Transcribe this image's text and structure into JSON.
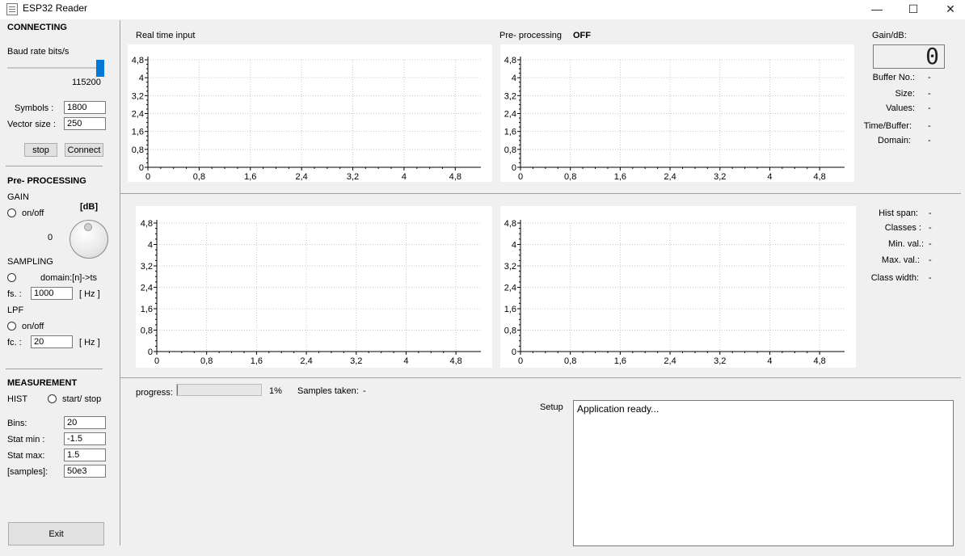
{
  "window": {
    "title": "ESP32 Reader",
    "minimize": "—",
    "maximize": "☐",
    "close": "✕"
  },
  "connecting": {
    "heading": "CONNECTING",
    "baud_label": "Baud rate bits/s",
    "baud_value": "115200",
    "symbols_label": "Symbols :",
    "symbols_value": "1800",
    "vector_label": "Vector size :",
    "vector_value": "250",
    "stop_label": "stop",
    "connect_label": "Connect"
  },
  "preprocessing": {
    "heading": "Pre- PROCESSING",
    "gain_label": "GAIN",
    "gain_onoff": "on/off",
    "db_label": "[dB]",
    "gain_value": "0",
    "sampling_label": "SAMPLING",
    "domain_label": "domain:[n]->ts",
    "fs_label": "fs. :",
    "fs_value": "1000",
    "hz1": "[ Hz ]",
    "lpf_label": "LPF",
    "lpf_onoff": "on/off",
    "fc_label": "fc. :",
    "fc_value": "20",
    "hz2": "[ Hz ]"
  },
  "measurement": {
    "heading": "MEASUREMENT",
    "hist_label": "HIST",
    "startstop_label": "start/ stop",
    "bins_label": "Bins:",
    "bins_value": "20",
    "statmin_label": "Stat min :",
    "statmin_value": "-1.5",
    "statmax_label": "Stat max:",
    "statmax_value": "1.5",
    "samples_label": "[samples]:",
    "samples_value": "50e3",
    "exit_label": "Exit"
  },
  "plots": {
    "realtime_label": "Real time input",
    "preproc_label": "Pre- processing",
    "preproc_state": "OFF",
    "yticks": [
      "0",
      "0,8",
      "1,6",
      "2,4",
      "3,2",
      "4",
      "4,8"
    ],
    "xticks": [
      "0",
      "0,8",
      "1,6",
      "2,4",
      "3,2",
      "4",
      "4,8"
    ]
  },
  "info": {
    "gain_db_label": "Gain/dB:",
    "gain_display": "0",
    "buffer_no_label": "Buffer No.:",
    "buffer_no_value": "-",
    "size_label": "Size:",
    "size_value": "-",
    "values_label": "Values:",
    "values_value": "-",
    "time_buffer_label": "Time/Buffer:",
    "time_buffer_value": "-",
    "domain_label": "Domain:",
    "domain_value": "-",
    "hist_span_label": "Hist span:",
    "hist_span_value": "-",
    "classes_label": "Classes :",
    "classes_value": "-",
    "min_val_label": "Min. val.:",
    "min_val_value": "-",
    "max_val_label": "Max. val.:",
    "max_val_value": "-",
    "class_width_label": "Class width:",
    "class_width_value": "-"
  },
  "bottom": {
    "progress_label": "progress:",
    "progress_value": 0.01,
    "progress_text": "1%",
    "samples_taken_label": "Samples taken:",
    "samples_taken_value": "-",
    "setup_label": "Setup",
    "log_text": "Application ready..."
  }
}
